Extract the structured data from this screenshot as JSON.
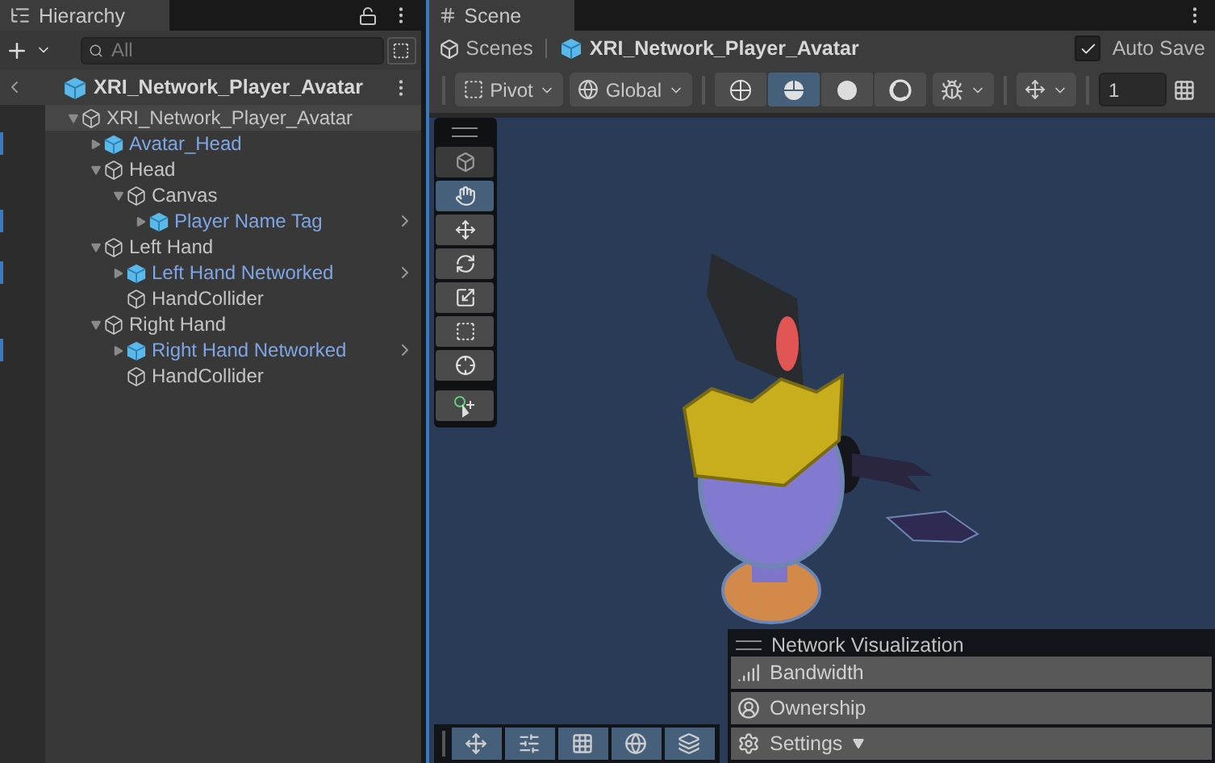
{
  "hierarchy": {
    "title": "Hierarchy",
    "search": {
      "placeholder": "All"
    },
    "prefab_header": "XRI_Network_Player_Avatar",
    "tree": [
      {
        "name": "XRI_Network_Player_Avatar",
        "prefab": false,
        "expanded": true,
        "selected": true,
        "nested": false,
        "children": [
          {
            "name": "Avatar_Head",
            "prefab": true,
            "expanded": false,
            "selected": false,
            "nested": false
          },
          {
            "name": "Head",
            "prefab": false,
            "expanded": true,
            "selected": false,
            "nested": false,
            "children": [
              {
                "name": "Canvas",
                "prefab": false,
                "expanded": true,
                "selected": false,
                "nested": false,
                "children": [
                  {
                    "name": "Player Name Tag",
                    "prefab": true,
                    "expanded": false,
                    "selected": false,
                    "nested": true
                  }
                ]
              }
            ]
          },
          {
            "name": "Left Hand",
            "prefab": false,
            "expanded": true,
            "selected": false,
            "nested": false,
            "children": [
              {
                "name": "Left Hand Networked",
                "prefab": true,
                "expanded": false,
                "selected": false,
                "nested": true
              },
              {
                "name": "HandCollider",
                "prefab": false,
                "selected": false,
                "nested": false
              }
            ]
          },
          {
            "name": "Right Hand",
            "prefab": false,
            "expanded": true,
            "selected": false,
            "nested": false,
            "children": [
              {
                "name": "Right Hand Networked",
                "prefab": true,
                "expanded": false,
                "selected": false,
                "nested": true
              },
              {
                "name": "HandCollider",
                "prefab": false,
                "selected": false,
                "nested": false
              }
            ]
          }
        ]
      }
    ]
  },
  "scene": {
    "title": "Scene",
    "breadcrumb": {
      "root": "Scenes",
      "prefab": "XRI_Network_Player_Avatar"
    },
    "auto_save": {
      "label": "Auto Save",
      "checked": true
    },
    "pivot": "Pivot",
    "space": "Global",
    "shading_modes": [
      {
        "kind": "wireframe",
        "selected": false
      },
      {
        "kind": "shaded-wireframe",
        "selected": true
      },
      {
        "kind": "shaded",
        "selected": false
      },
      {
        "kind": "unlit",
        "selected": false
      }
    ],
    "snap_value": "1",
    "tools": [
      {
        "kind": "view",
        "selected": true
      },
      {
        "kind": "move",
        "selected": false
      },
      {
        "kind": "rotate",
        "selected": false
      },
      {
        "kind": "scale",
        "selected": false
      },
      {
        "kind": "rect",
        "selected": false
      },
      {
        "kind": "transform",
        "selected": false
      }
    ],
    "network_visualization": {
      "title": "Network Visualization",
      "items": [
        {
          "kind": "bandwidth",
          "label": "Bandwidth",
          "dropdown": false
        },
        {
          "kind": "ownership",
          "label": "Ownership",
          "dropdown": false
        },
        {
          "kind": "settings",
          "label": "Settings",
          "dropdown": true
        }
      ]
    }
  }
}
